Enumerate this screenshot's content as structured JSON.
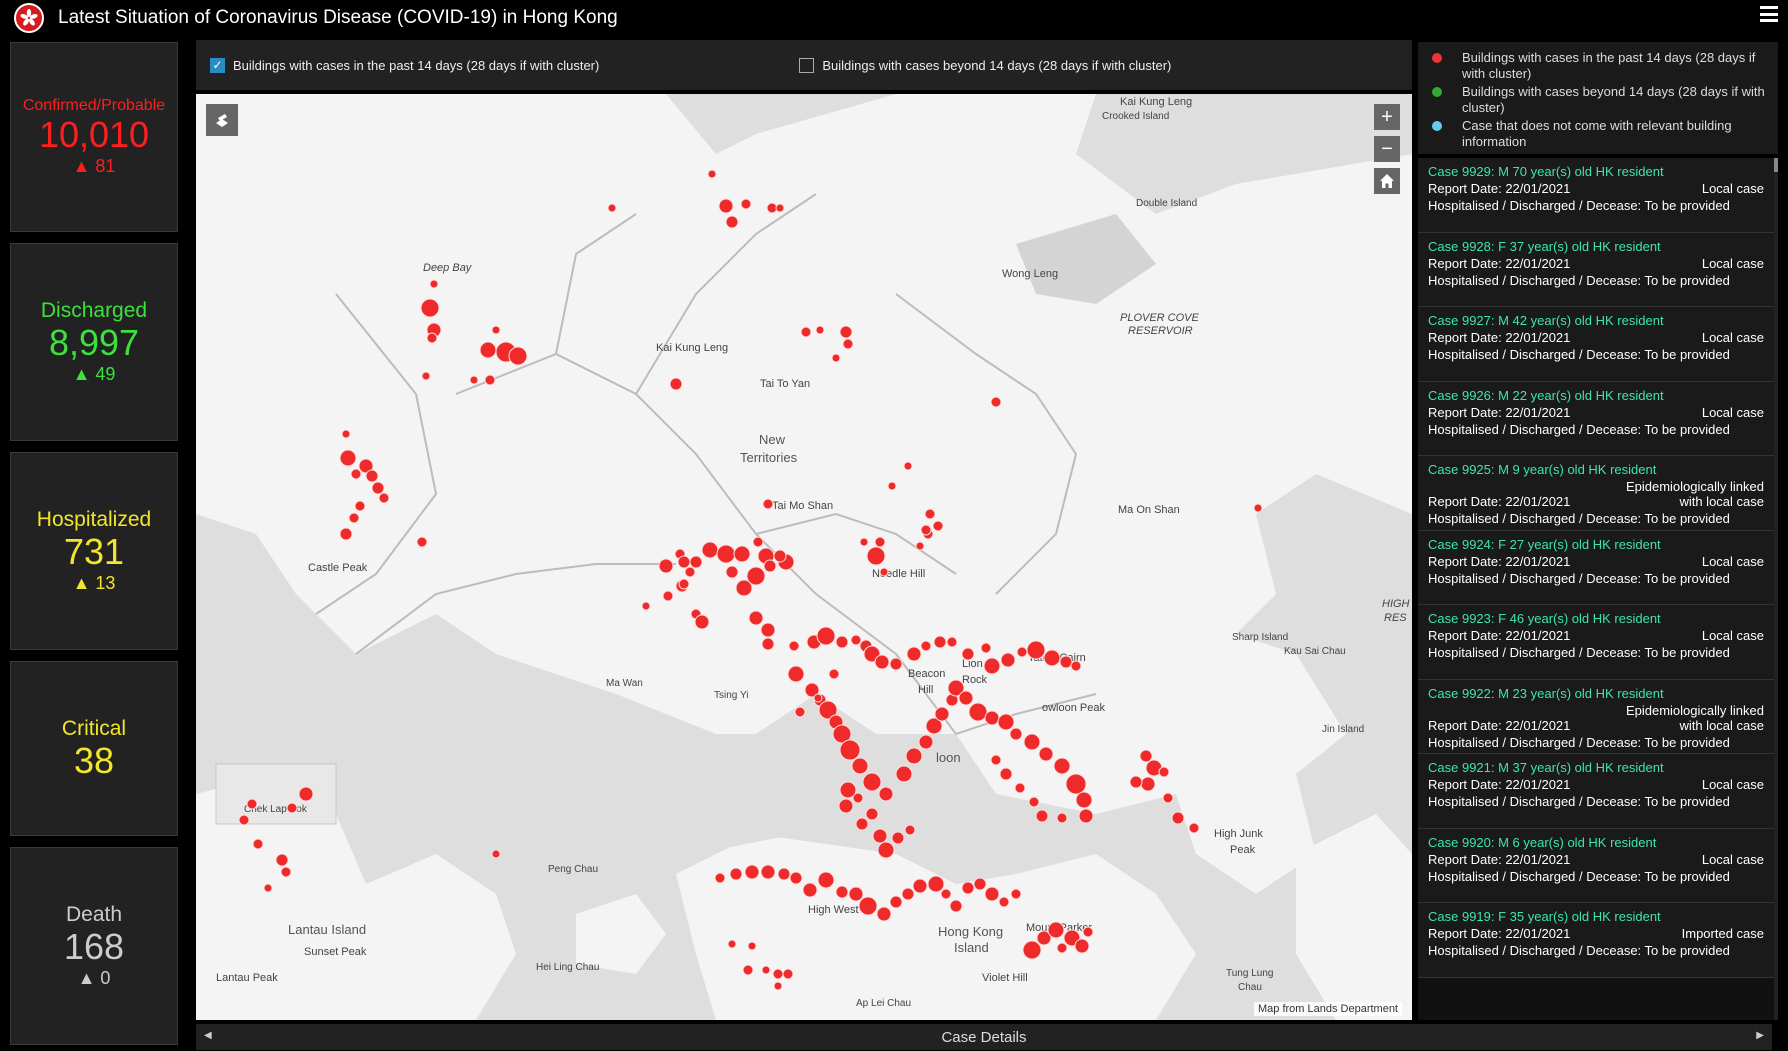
{
  "header": {
    "title": "Latest Situation of Coronavirus Disease (COVID-19) in Hong Kong"
  },
  "stats": {
    "confirmed": {
      "label": "Confirmed/Probable",
      "value": "10,010",
      "delta": "▲ 81",
      "color": "#ff1e1e"
    },
    "discharged": {
      "label": "Discharged",
      "value": "8,997",
      "delta": "▲ 49",
      "color": "#3ee03e"
    },
    "hospitalized": {
      "label": "Hospitalized",
      "value": "731",
      "delta": "▲ 13",
      "color": "#f2e62b"
    },
    "critical": {
      "label": "Critical",
      "value": "38",
      "color": "#f2e62b"
    },
    "death": {
      "label": "Death",
      "value": "168",
      "delta": "▲ 0",
      "color": "#cccccc"
    }
  },
  "filters": {
    "recent": {
      "label": "Buildings with cases in the past 14 days (28 days if with cluster)",
      "checked": true
    },
    "beyond": {
      "label": "Buildings with cases beyond 14 days (28 days if with cluster)",
      "checked": false
    }
  },
  "legend": [
    {
      "label": "Buildings with cases in the past 14 days (28 days if with cluster)",
      "color": "#ee3333"
    },
    {
      "label": "Buildings with cases beyond 14 days (28 days if with cluster)",
      "color": "#33aa33"
    },
    {
      "label": "Case that does not come with relevant building information",
      "color": "#66ccee"
    }
  ],
  "map": {
    "attribution": "Map from Lands Department",
    "labels": {
      "kai_kung_leng_ne": "Kai Kung Leng",
      "crooked_island": "Crooked Island",
      "double_island": "Double Island",
      "deep_bay": "Deep Bay",
      "wong_leng": "Wong Leng",
      "plover_cove": "PLOVER COVE",
      "reservoir": "RESERVOIR",
      "kai_kung_leng": "Kai Kung Leng",
      "tai_to_yan": "Tai To Yan",
      "new": "New",
      "territories": "Territories",
      "tai_mo_shan": "Tai Mo Shan",
      "ma_on_shan": "Ma On Shan",
      "castle_peak": "Castle Peak",
      "needle_hill": "Needle Hill",
      "sharp_island": "Sharp Island",
      "kau_sai_chau": "Kau Sai Chau",
      "high": "HIGH",
      "res": "RES",
      "ma_wan": "Ma Wan",
      "tsing_yi": "Tsing Yi",
      "beacon": "Beacon",
      "hill": "Hill",
      "lion": "Lion",
      "rock": "Rock",
      "tates_cairn": "Tate's Cairn",
      "kowloon_peak": "owloon Peak",
      "kowloon": "loon",
      "jin_island": "Jin Island",
      "chek_lap_kok": "Chek Lap Kok",
      "peng_chau": "Peng Chau",
      "high_junk": "High Junk",
      "peak": "Peak",
      "high_west": "High West",
      "lantau_island": "Lantau Island",
      "sunset_peak": "Sunset Peak",
      "hong_kong": "Hong Kong",
      "island": "Island",
      "mount_parker": "Mount Parker",
      "hei_ling_chau": "Hei Ling Chau",
      "tung_lung": "Tung Lung",
      "chau": "Chau",
      "lantau_peak": "Lantau Peak",
      "violet_hill": "Violet Hill",
      "ap_lei_chau": "Ap Lei Chau"
    }
  },
  "cases": [
    {
      "title": "Case 9929: M 70 year(s) old  HK resident",
      "date": "Report Date: 22/01/2021",
      "type": "Local case",
      "status": "Hospitalised / Discharged / Decease: To be provided"
    },
    {
      "title": "Case 9928: F 37 year(s) old  HK resident",
      "date": "Report Date: 22/01/2021",
      "type": "Local case",
      "status": "Hospitalised / Discharged / Decease: To be provided"
    },
    {
      "title": "Case 9927: M 42 year(s) old  HK resident",
      "date": "Report Date: 22/01/2021",
      "type": "Local case",
      "status": "Hospitalised / Discharged / Decease: To be provided"
    },
    {
      "title": "Case 9926: M 22 year(s) old  HK resident",
      "date": "Report Date: 22/01/2021",
      "type": "Local case",
      "status": "Hospitalised / Discharged / Decease: To be provided"
    },
    {
      "title": "Case 9925: M 9 year(s) old  HK resident",
      "date": "Report Date: 22/01/2021",
      "type": "Epidemiologically linked with local case",
      "status": "Hospitalised / Discharged / Decease: To be provided"
    },
    {
      "title": "Case 9924: F 27 year(s) old  HK resident",
      "date": "Report Date: 22/01/2021",
      "type": "Local case",
      "status": "Hospitalised / Discharged / Decease: To be provided"
    },
    {
      "title": "Case 9923: F 46 year(s) old  HK resident",
      "date": "Report Date: 22/01/2021",
      "type": "Local case",
      "status": "Hospitalised / Discharged / Decease: To be provided"
    },
    {
      "title": "Case 9922: M 23 year(s) old  HK resident",
      "date": "Report Date: 22/01/2021",
      "type": "Epidemiologically linked with local case",
      "status": "Hospitalised / Discharged / Decease: To be provided"
    },
    {
      "title": "Case 9921: M 37 year(s) old  HK resident",
      "date": "Report Date: 22/01/2021",
      "type": "Local case",
      "status": "Hospitalised / Discharged / Decease: To be provided"
    },
    {
      "title": "Case 9920: M 6 year(s) old  HK resident",
      "date": "Report Date: 22/01/2021",
      "type": "Local case",
      "status": "Hospitalised / Discharged / Decease: To be provided"
    },
    {
      "title": "Case 9919: F 35 year(s) old  HK resident",
      "date": "Report Date: 22/01/2021",
      "type": "Imported case",
      "status": "Hospitalised / Discharged / Decease: To be provided"
    }
  ],
  "bottom_bar": {
    "label": "Case Details"
  }
}
